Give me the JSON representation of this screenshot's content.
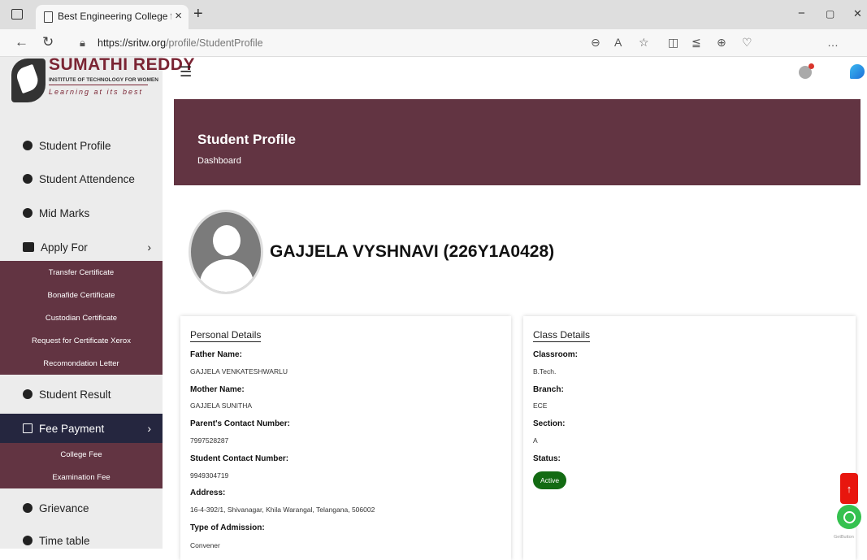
{
  "browser": {
    "tab_title": "Best Engineering College for Wo",
    "tab_close": "×",
    "new_tab": "+",
    "url_host": "https://sritw.org",
    "url_path": "/profile/StudentProfile",
    "minimize": "−",
    "maximize": "▢",
    "close": "✕"
  },
  "logo": {
    "title": "SUMATHI REDDY",
    "subtitle": "INSTITUTE OF TECHNOLOGY FOR WOMEN",
    "tagline": "Learning at its best"
  },
  "sidebar": {
    "items": [
      {
        "label": "Student Profile",
        "icon": "dashboard-icon"
      },
      {
        "label": "Student Attendence",
        "icon": "dashboard-icon"
      },
      {
        "label": "Mid Marks",
        "icon": "dashboard-icon"
      },
      {
        "label": "Apply For",
        "icon": "users-icon"
      },
      {
        "label": "Student Result",
        "icon": "dashboard-icon"
      },
      {
        "label": "Fee Payment",
        "icon": "list-icon"
      },
      {
        "label": "Grievance",
        "icon": "dashboard-icon"
      },
      {
        "label": "Time table",
        "icon": "dashboard-icon"
      }
    ],
    "apply_for_sub": [
      "Transfer Certificate",
      "Bonafide Certificate",
      "Custodian Certificate",
      "Request for Certificate Xerox",
      "Recomondation Letter"
    ],
    "fee_payment_sub": [
      "College Fee",
      "Examination Fee"
    ],
    "chevron": "›",
    "active_bg": "#25263f",
    "submenu_bg": "#623442"
  },
  "header": {
    "menu_icon": "☰",
    "banner_title": "Student Profile",
    "breadcrumb": "Dashboard",
    "banner_color": "#623442"
  },
  "profile": {
    "name": "GAJJELA VYSHNAVI (226Y1A0428)"
  },
  "personal": {
    "title": "Personal Details",
    "father_label": "Father Name:",
    "father_value": "GAJJELA VENKATESHWARLU",
    "mother_label": "Mother Name:",
    "mother_value": "GAJJELA SUNITHA",
    "parent_contact_label": "Parent's Contact Number:",
    "parent_contact_value": "7997528287",
    "student_contact_label": "Student Contact Number:",
    "student_contact_value": "9949304719",
    "address_label": "Address:",
    "address_value": "16-4-392/1, Shivanagar, Khila Warangal, Telangana, 506002",
    "admission_label": "Type of Admission:",
    "admission_value": "Convener"
  },
  "class_details": {
    "title": "Class Details",
    "classroom_label": "Classroom:",
    "classroom_value": "B.Tech.",
    "branch_label": "Branch:",
    "branch_value": "ECE",
    "section_label": "Section:",
    "section_value": "A",
    "status_label": "Status:",
    "status_value": "Active",
    "status_color": "#136b13"
  },
  "floating": {
    "scroll_top": "↑",
    "getbutton": "GetButton"
  }
}
